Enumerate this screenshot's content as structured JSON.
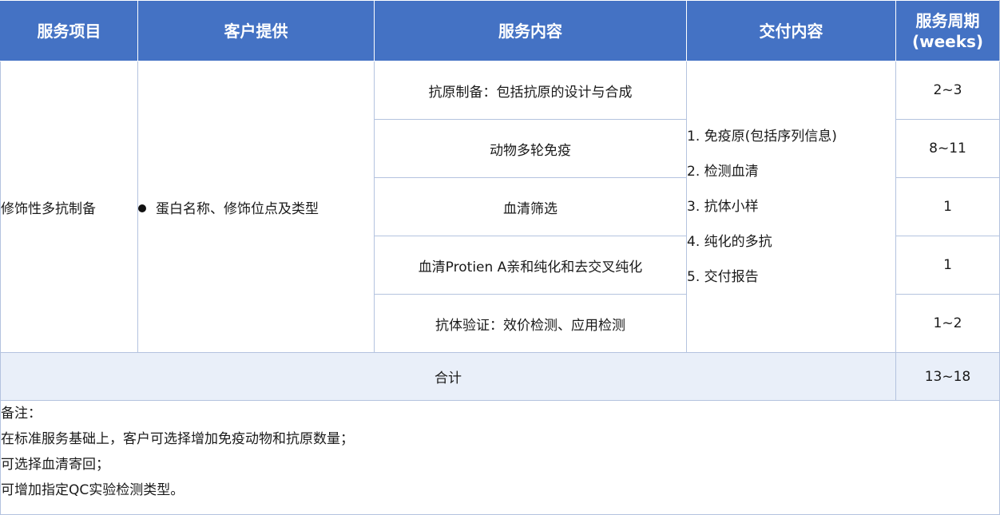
{
  "header": {
    "col1": "服务项目",
    "col2": "客户提供",
    "col3": "服务内容",
    "col4": "交付内容",
    "col5_line1": "服务周期",
    "col5_line2": "(weeks)"
  },
  "service_item": "修饰性多抗制备",
  "customer_provides": "蛋白名称、修饰位点及类型",
  "rows": [
    {
      "content": "抗原制备：包括抗原的设计与合成",
      "period": "2~3"
    },
    {
      "content": "动物多轮免疫",
      "period": "8~11"
    },
    {
      "content": "血清筛选",
      "period": "1"
    },
    {
      "content": "血清Protien A亲和纯化和去交叉纯化",
      "period": "1"
    },
    {
      "content": "抗体验证：效价检测、应用检测",
      "period": "1~2"
    }
  ],
  "deliverables": [
    "1. 免疫原(包括序列信息)",
    "2. 检测血清",
    "3. 抗体小样",
    "4. 纯化的多抗",
    "5. 交付报告"
  ],
  "total": {
    "label": "合计",
    "period": "13~18"
  },
  "notes": [
    "备注：",
    "在标准服务基础上，客户可选择增加免疫动物和抗原数量；",
    "可选择血清寄回；",
    "可增加指定QC实验检测类型。"
  ],
  "colors": {
    "header_bg": "#4472c4",
    "border": "#b4c3df",
    "total_bg": "#e9eff9"
  }
}
